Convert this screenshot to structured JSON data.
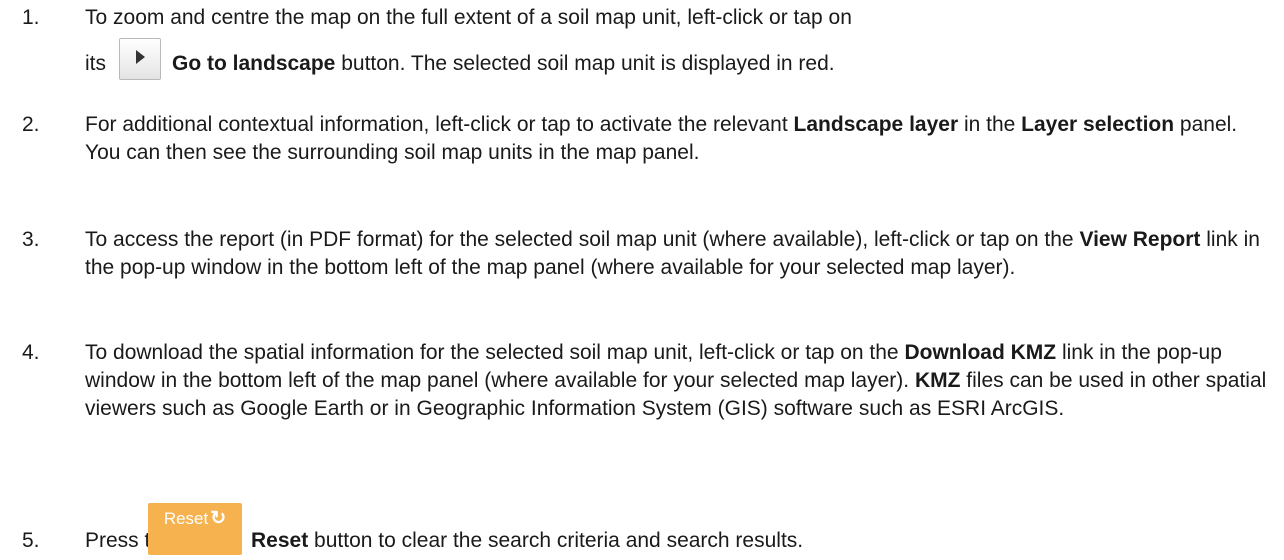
{
  "steps": [
    {
      "number": "1.",
      "line1": "To zoom and centre the map on the full extent of a soil map unit, left-click or tap on",
      "line2_prefix": "its",
      "button_label": "Go to landscape",
      "line2_suffix": " button. The selected soil map unit is displayed in red."
    },
    {
      "number": "2.",
      "text_a": "For additional contextual information, left-click or tap to activate the relevant ",
      "bold_a": "Landscape layer",
      "text_b": " in the ",
      "bold_b": "Layer selection",
      "text_c": " panel. You can then see the surrounding soil map units in the map panel."
    },
    {
      "number": "3.",
      "text_a": "To access the report (in PDF format) for the selected soil map unit (where available), left-click or tap on the ",
      "bold_a": "View Report",
      "text_b": " link in the pop-up window in the bottom left of the map panel (where available for your selected map layer)."
    },
    {
      "number": "4.",
      "text_a": "To download the spatial information for the selected soil map unit, left-click or tap on the ",
      "bold_a": "Download KMZ",
      "text_b": " link in the pop-up window in the bottom left of the map panel (where available for your selected map layer). ",
      "bold_b": "KMZ",
      "text_c": " files can be used in other spatial viewers such as Google Earth or in Geographic Information System (GIS) software such as ESRI ArcGIS."
    },
    {
      "number": "5.",
      "text_a": "Press the",
      "bold_a": "Reset",
      "text_b": " button to clear the search criteria and search results."
    }
  ],
  "reset_button": {
    "label": "Reset",
    "icon": "refresh-icon",
    "color": "#f6b24f"
  },
  "go_button": {
    "icon": "play-triangle-icon"
  }
}
